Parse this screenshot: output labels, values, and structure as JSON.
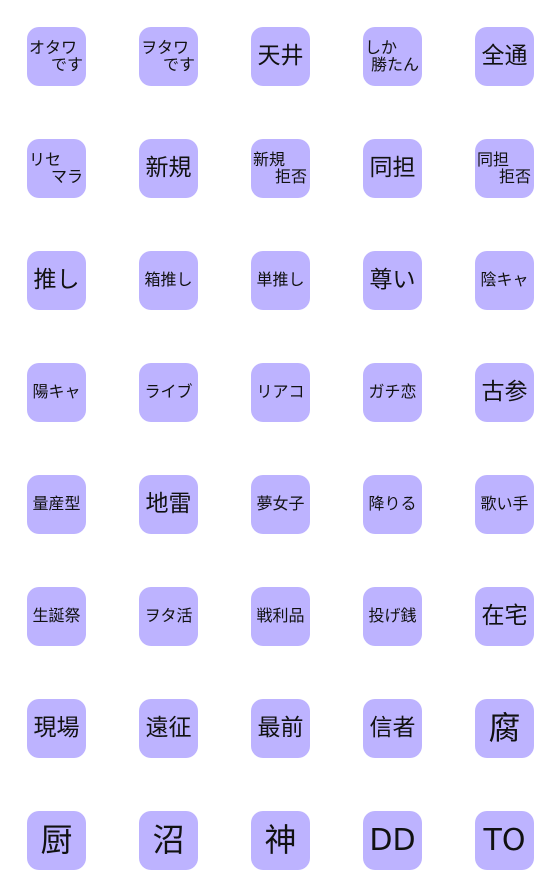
{
  "tile_color": "#bdb3ff",
  "stickers": [
    {
      "lines": [
        "オタワ",
        "です"
      ]
    },
    {
      "lines": [
        "ヲタワ",
        "です"
      ]
    },
    {
      "lines": [
        "天井"
      ]
    },
    {
      "lines": [
        "しか",
        "勝たん"
      ]
    },
    {
      "lines": [
        "全通"
      ]
    },
    {
      "lines": [
        "リセ",
        "マラ"
      ]
    },
    {
      "lines": [
        "新規"
      ]
    },
    {
      "lines": [
        "新規",
        "拒否"
      ]
    },
    {
      "lines": [
        "同担"
      ]
    },
    {
      "lines": [
        "同担",
        "拒否"
      ]
    },
    {
      "lines": [
        "推し"
      ]
    },
    {
      "lines": [
        "箱推し"
      ]
    },
    {
      "lines": [
        "単推し"
      ]
    },
    {
      "lines": [
        "尊い"
      ]
    },
    {
      "lines": [
        "陰キャ"
      ]
    },
    {
      "lines": [
        "陽キャ"
      ]
    },
    {
      "lines": [
        "ライブ"
      ]
    },
    {
      "lines": [
        "リアコ"
      ]
    },
    {
      "lines": [
        "ガチ恋"
      ]
    },
    {
      "lines": [
        "古参"
      ]
    },
    {
      "lines": [
        "量産型"
      ]
    },
    {
      "lines": [
        "地雷"
      ]
    },
    {
      "lines": [
        "夢女子"
      ]
    },
    {
      "lines": [
        "降りる"
      ]
    },
    {
      "lines": [
        "歌い手"
      ]
    },
    {
      "lines": [
        "生誕祭"
      ]
    },
    {
      "lines": [
        "ヲタ活"
      ]
    },
    {
      "lines": [
        "戦利品"
      ]
    },
    {
      "lines": [
        "投げ銭"
      ]
    },
    {
      "lines": [
        "在宅"
      ]
    },
    {
      "lines": [
        "現場"
      ]
    },
    {
      "lines": [
        "遠征"
      ]
    },
    {
      "lines": [
        "最前"
      ]
    },
    {
      "lines": [
        "信者"
      ]
    },
    {
      "lines": [
        "腐"
      ]
    },
    {
      "lines": [
        "厨"
      ]
    },
    {
      "lines": [
        "沼"
      ]
    },
    {
      "lines": [
        "神"
      ]
    },
    {
      "lines": [
        "DD"
      ]
    },
    {
      "lines": [
        "TO"
      ]
    }
  ]
}
